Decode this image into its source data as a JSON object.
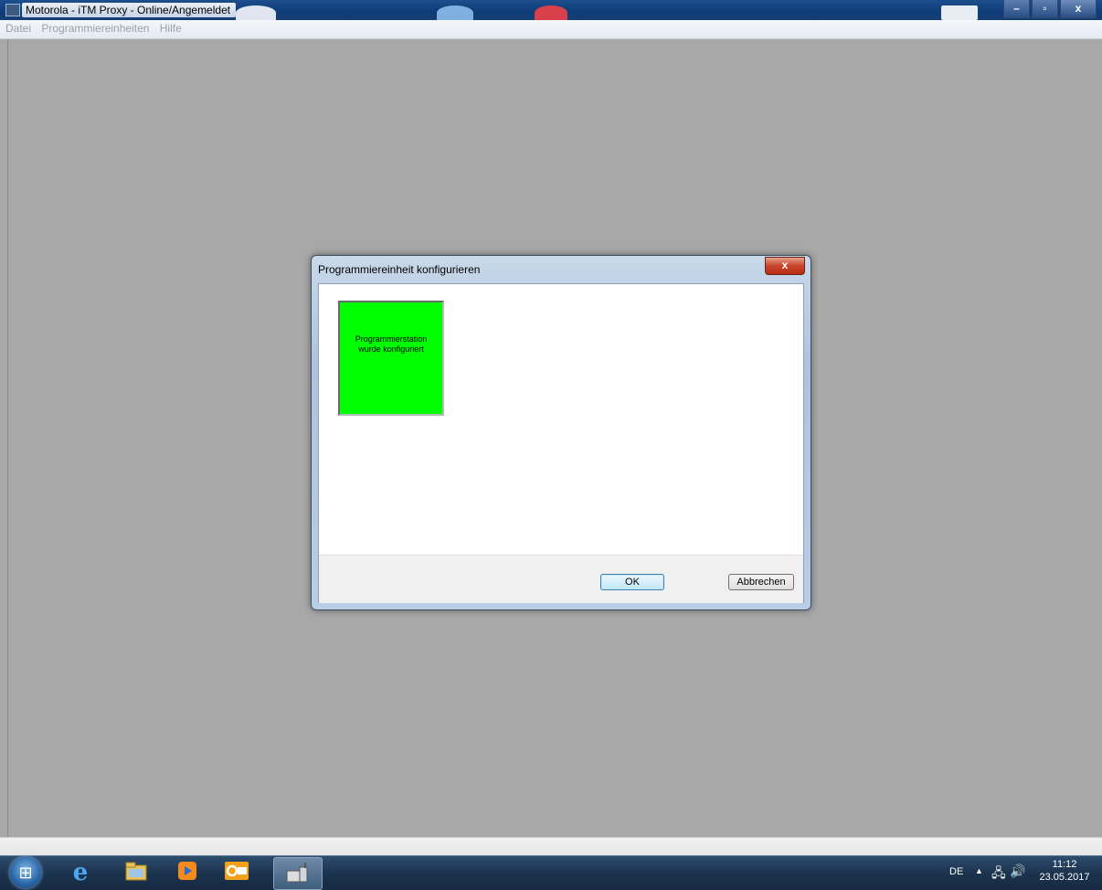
{
  "window": {
    "title": "Motorola - iTM Proxy - Online/Angemeldet",
    "minimize": "–",
    "maximize": "▫",
    "close": "x"
  },
  "menu": {
    "items": [
      "Datei",
      "Programmiereinheiten",
      "Hilfe"
    ]
  },
  "dialog": {
    "title": "Programmiereinheit konfigurieren",
    "close": "x",
    "tile": {
      "line1": "Programmierstation",
      "line2": "wurde konfiguriert",
      "color": "#00ff00"
    },
    "ok_label": "OK",
    "cancel_label": "Abbrechen"
  },
  "taskbar": {
    "icons": [
      "windows-start",
      "internet-explorer",
      "file-explorer",
      "media-player",
      "outlook",
      "itm-proxy"
    ],
    "language": "DE",
    "time": "11:12",
    "date": "23.05.2017"
  }
}
